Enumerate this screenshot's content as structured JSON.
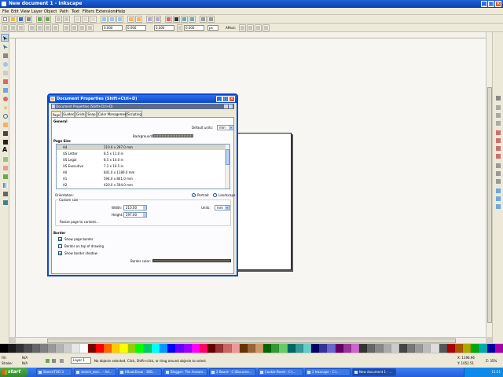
{
  "window": {
    "title": "New document 1 - Inkscape",
    "minimize": "_",
    "maximize": "□",
    "close": "×"
  },
  "menu": [
    "File",
    "Edit",
    "View",
    "Layer",
    "Object",
    "Path",
    "Text",
    "Filters",
    "Extensions",
    "Help"
  ],
  "controls": {
    "x_value": "0.000",
    "y_value": "0.000",
    "w_value": "0.000",
    "h_value": "0.000",
    "unit": "px",
    "affect_label": "Affect:"
  },
  "dialog": {
    "title": "Document Properties (Shift+Ctrl+D)",
    "dock_title": "Document Properties (Shift+Ctrl+D)",
    "tabs": [
      "Page",
      "Guides",
      "Grids",
      "Snap",
      "Color Management",
      "Scripting"
    ],
    "general_label": "General",
    "default_units_label": "Default units:",
    "default_units_value": "mm",
    "background_label": "Background:",
    "page_size_label": "Page Size",
    "page_sizes": [
      {
        "name": "A4",
        "size": "210.0 x 297.0 mm"
      },
      {
        "name": "US Letter",
        "size": "8.5 x 11.0 in"
      },
      {
        "name": "US Legal",
        "size": "8.5 x 14.0 in"
      },
      {
        "name": "US Executive",
        "size": "7.2 x 10.5 in"
      },
      {
        "name": "A0",
        "size": "841.0 x 1189.0 mm"
      },
      {
        "name": "A1",
        "size": "594.0 x 841.0 mm"
      },
      {
        "name": "A2",
        "size": "420.0 x 594.0 mm"
      }
    ],
    "orientation_label": "Orientation:",
    "portrait_label": "Portrait",
    "landscape_label": "Landscape",
    "custom_size_label": "Custom size",
    "width_label": "Width:",
    "width_value": "210.00",
    "height_label": "Height:",
    "height_value": "297.00",
    "units_label": "Units:",
    "units_value": "mm",
    "resize_label": "Resize page to content...",
    "border_label": "Border",
    "show_page_border": "Show page border",
    "border_on_top": "Border on top of drawing",
    "show_border_shadow": "Show border shadow",
    "border_color_label": "Border color:"
  },
  "status": {
    "fill_label": "Fill:",
    "fill_value": "N/A",
    "stroke_label": "Stroke:",
    "stroke_value": "N/A",
    "layer": "Layer 1",
    "message": "No objects selected. Click, Shift+click, or drag around objects to select.",
    "x_coord": "X: 1196.96",
    "y_coord": "Y: 1052.51",
    "zoom": "Z: 35%"
  },
  "taskbar": {
    "start": "start",
    "tasks": [
      "SketchTOD 3",
      "sketch_tool... - Ad...",
      "KBookDraw - 3KB...",
      "Blogger: The Answer...",
      "2 Board - C:\\Docume...",
      "Cookie Reset - C:\\...",
      "2 Inkscape - C:\\...",
      "New document 1 - ..."
    ],
    "clock": "11:51"
  },
  "colors": {
    "accent": "#0a46d4",
    "canvas": "#f7f6f3",
    "page_border": "#222222"
  }
}
